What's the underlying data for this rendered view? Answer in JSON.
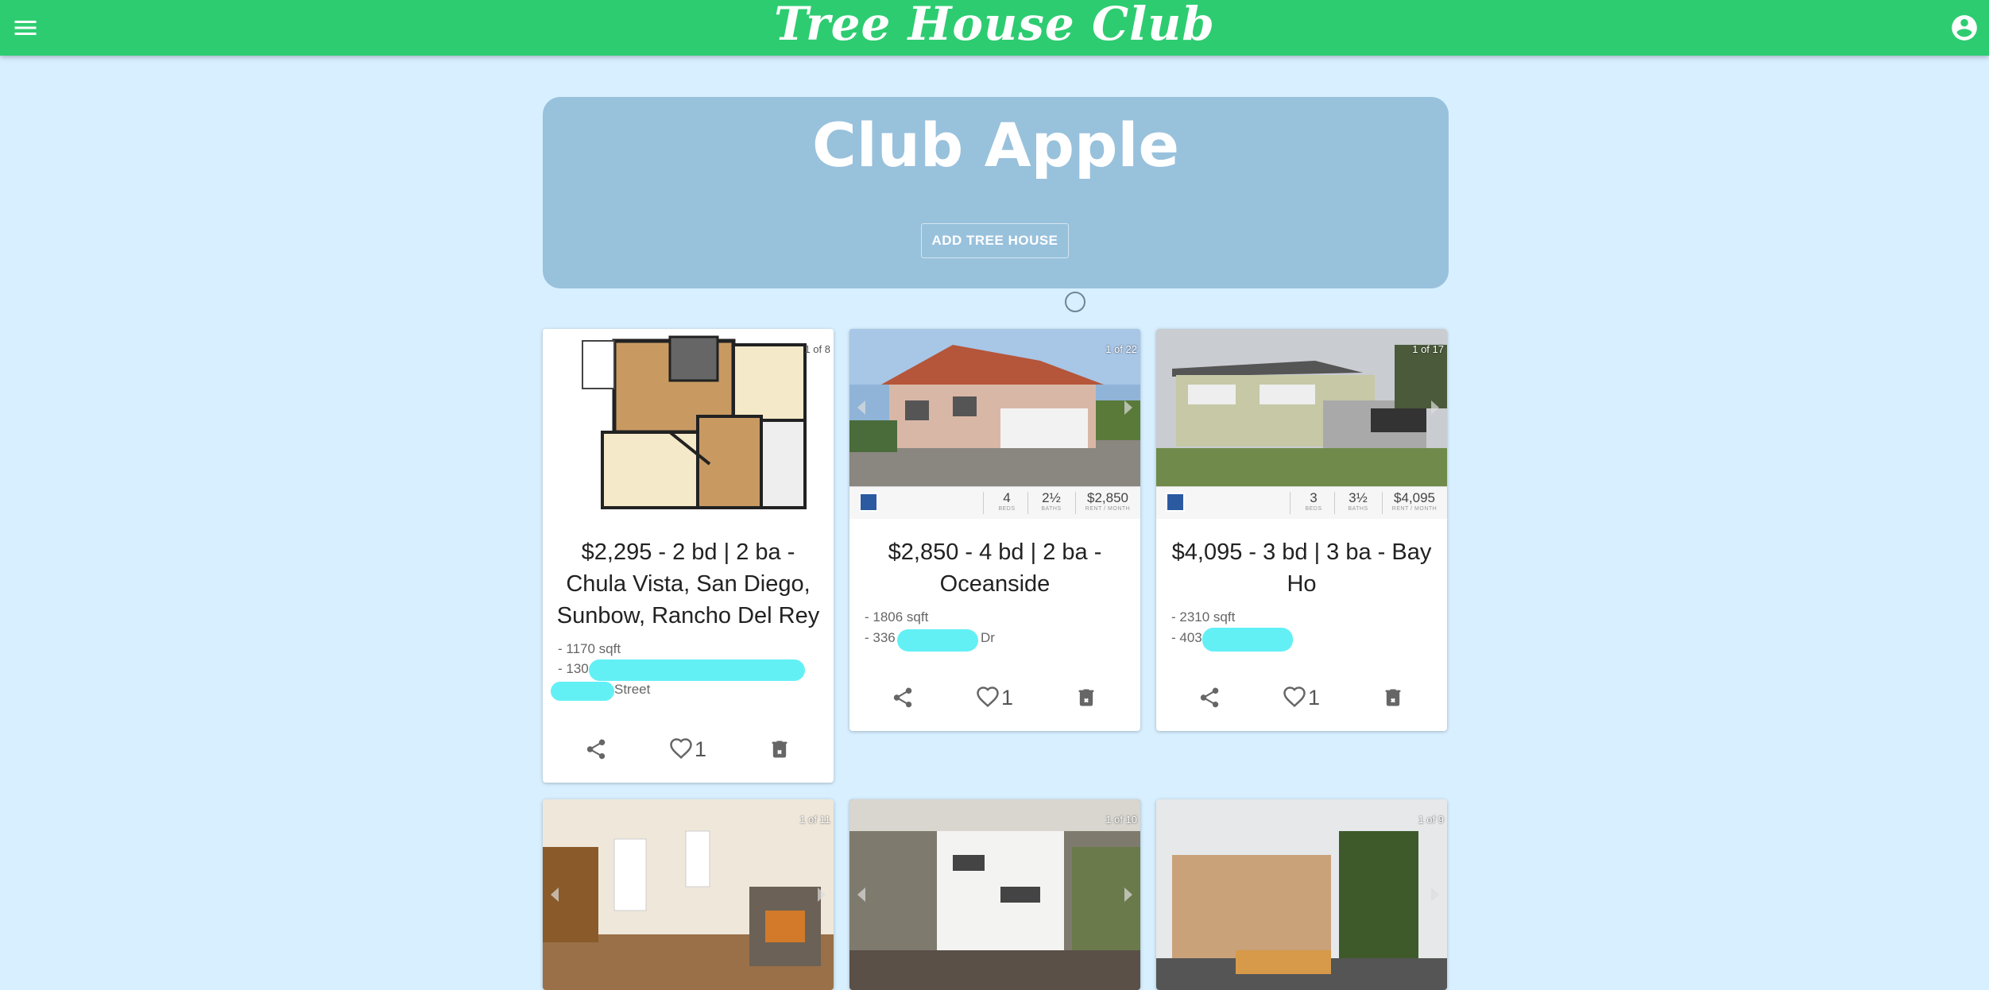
{
  "app": {
    "title": "Tree House Club"
  },
  "club": {
    "name": "Club Apple",
    "add_button": "ADD TREE HOUSE"
  },
  "listings": [
    {
      "counter": "1 of 8",
      "title": "$2,295 - 2 bd | 2 ba - Chula Vista, San Diego, Sunbow, Rancho Del Rey",
      "sqft": "- 1170 sqft",
      "address_prefix": "- 130",
      "address_suffix": "Street",
      "likes": "1"
    },
    {
      "counter": "1 of 22",
      "strip": {
        "beds": "4",
        "beds_label": "BEDS",
        "baths": "2½",
        "baths_label": "BATHS",
        "rent": "$2,850",
        "rent_label": "RENT / MONTH"
      },
      "title": "$2,850 - 4 bd | 2 ba - Oceanside",
      "sqft": "- 1806 sqft",
      "address_prefix": "- 336",
      "address_suffix": "Dr",
      "likes": "1"
    },
    {
      "counter": "1 of 17",
      "strip": {
        "beds": "3",
        "beds_label": "BEDS",
        "baths": "3½",
        "baths_label": "BATHS",
        "rent": "$4,095",
        "rent_label": "RENT / MONTH"
      },
      "title": "$4,095 - 3 bd | 3 ba - Bay Ho",
      "sqft": "- 2310 sqft",
      "address_prefix": "- 403",
      "address_suffix": "",
      "likes": "1"
    },
    {
      "counter": "1 of 11"
    },
    {
      "counter": "1 of 10"
    },
    {
      "counter": "1 of 9"
    }
  ],
  "colors": {
    "appbar": "#2ecc71",
    "background": "#d7efff",
    "club_panel": "#98c1dc",
    "redaction": "#62f0f5"
  },
  "icons": [
    "menu-icon",
    "account-circle-icon",
    "share-icon",
    "heart-outline-icon",
    "delete-icon",
    "chevron-left-icon",
    "chevron-right-icon"
  ]
}
